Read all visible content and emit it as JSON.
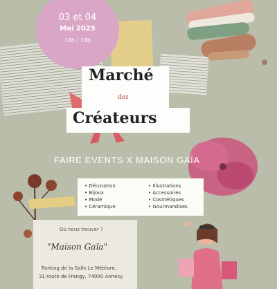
{
  "date": {
    "days": "03 et 04",
    "month_year": "Mai 2025",
    "hours": "10h / 18h"
  },
  "title": {
    "line1": "Marché",
    "connector": "des",
    "line2": "Créateurs"
  },
  "subtitle": "FAIRE EVENTS X MAISON GAÏA",
  "categories": {
    "left": [
      "Décoration",
      "Bijoux",
      "Mode",
      "Céramique"
    ],
    "right": [
      "Illustrations",
      "Accessoires",
      "Cosmétiques",
      "Gourmandises"
    ]
  },
  "location": {
    "question": "Où nous trouver ?",
    "name": "\"Maison Gaïa\"",
    "address_line1": "Parking de la Salle Le Météore,",
    "address_line2": "31 route de Frangy, 74000 Annecy"
  },
  "colors": {
    "background": "#b9bda9",
    "pink_circle": "#d9a6c6",
    "bow": "#e06a6e",
    "flower": "#c4547c"
  }
}
